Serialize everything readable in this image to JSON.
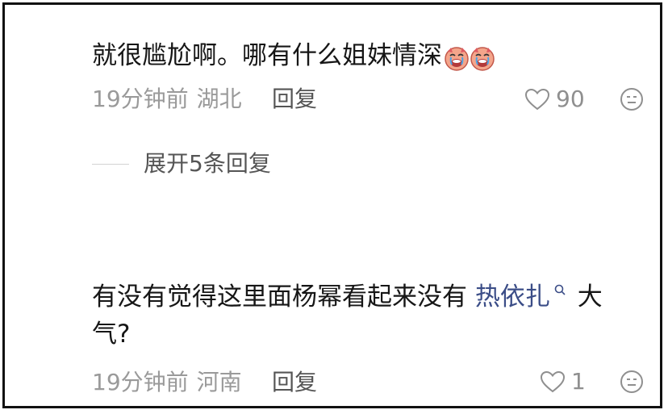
{
  "comments": [
    {
      "text": "就很尴尬啊。哪有什么姐妹情深",
      "emojis": [
        "crying-face-emoji",
        "crying-face-emoji"
      ],
      "time": "19分钟前",
      "location": "湖北",
      "reply_label": "回复",
      "like_count": "90",
      "expand_label": "展开5条回复"
    },
    {
      "text_before": "有没有觉得这里面杨幂看起来没有 ",
      "link_term": "热依扎",
      "text_after": " 大",
      "text_line2": "气?",
      "time": "19分钟前",
      "location": "河南",
      "reply_label": "回复",
      "like_count": "1"
    }
  ],
  "colors": {
    "text_primary": "#161616",
    "text_meta": "#9a9a9a",
    "text_action": "#555555",
    "link": "#3b4d87",
    "border": "#111111"
  },
  "icons": [
    "heart-outline-icon",
    "dislike-face-icon",
    "search-icon"
  ]
}
